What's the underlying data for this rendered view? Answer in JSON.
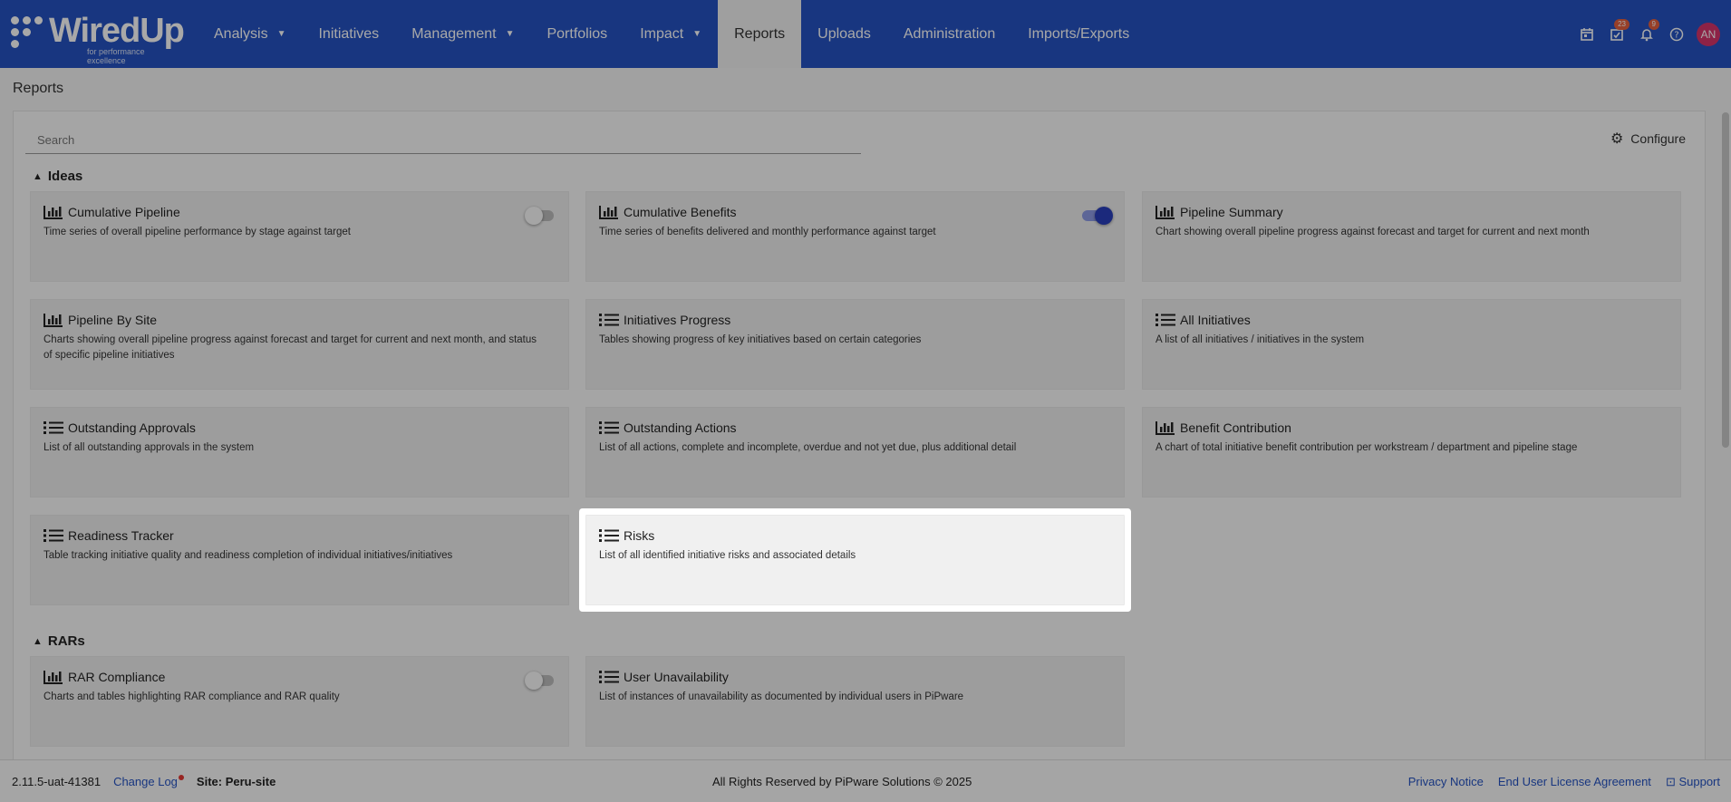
{
  "app": {
    "logo_text": "WiredUp",
    "logo_tagline": "for performance excellence"
  },
  "nav": [
    {
      "label": "Analysis",
      "dropdown": true,
      "active": false
    },
    {
      "label": "Initiatives",
      "dropdown": false,
      "active": false
    },
    {
      "label": "Management",
      "dropdown": true,
      "active": false
    },
    {
      "label": "Portfolios",
      "dropdown": false,
      "active": false
    },
    {
      "label": "Impact",
      "dropdown": true,
      "active": false
    },
    {
      "label": "Reports",
      "dropdown": false,
      "active": true
    },
    {
      "label": "Uploads",
      "dropdown": false,
      "active": false
    },
    {
      "label": "Administration",
      "dropdown": false,
      "active": false
    },
    {
      "label": "Imports/Exports",
      "dropdown": false,
      "active": false
    }
  ],
  "top_icons": {
    "tasks_badge": "23",
    "notifications_badge": "9",
    "avatar_initials": "AN"
  },
  "page": {
    "title": "Reports",
    "search_placeholder": "Search",
    "configure_label": "Configure"
  },
  "sections": [
    {
      "title": "Ideas",
      "cards": [
        {
          "icon": "bar-chart",
          "title": "Cumulative Pipeline",
          "desc": "Time series of overall pipeline performance by stage against target",
          "toggle": "off"
        },
        {
          "icon": "bar-chart",
          "title": "Cumulative Benefits",
          "desc": "Time series of benefits delivered and monthly performance against target",
          "toggle": "on"
        },
        {
          "icon": "bar-chart",
          "title": "Pipeline Summary",
          "desc": "Chart showing overall pipeline progress against forecast and target for current and next month",
          "toggle": null
        },
        {
          "icon": "bar-chart",
          "title": "Pipeline By Site",
          "desc": "Charts showing overall pipeline progress against forecast and target for current and next month, and status of specific pipeline initiatives",
          "toggle": null
        },
        {
          "icon": "list",
          "title": "Initiatives Progress",
          "desc": "Tables showing progress of key initiatives based on certain categories",
          "toggle": null
        },
        {
          "icon": "list",
          "title": "All Initiatives",
          "desc": "A list of all initiatives / initiatives in the system",
          "toggle": null
        },
        {
          "icon": "list",
          "title": "Outstanding Approvals",
          "desc": "List of all outstanding approvals in the system",
          "toggle": null
        },
        {
          "icon": "list",
          "title": "Outstanding Actions",
          "desc": "List of all actions, complete and incomplete, overdue and not yet due, plus additional detail",
          "toggle": null
        },
        {
          "icon": "bar-chart",
          "title": "Benefit Contribution",
          "desc": "A chart of total initiative benefit contribution per workstream / department and pipeline stage",
          "toggle": null
        },
        {
          "icon": "list",
          "title": "Readiness Tracker",
          "desc": "Table tracking initiative quality and readiness completion of individual initiatives/initiatives",
          "toggle": null
        },
        {
          "icon": "list",
          "title": "Risks",
          "desc": "List of all identified initiative risks and associated details",
          "toggle": null,
          "highlighted": true
        }
      ]
    },
    {
      "title": "RARs",
      "cards": [
        {
          "icon": "bar-chart",
          "title": "RAR Compliance",
          "desc": "Charts and tables highlighting RAR compliance and RAR quality",
          "toggle": "off"
        },
        {
          "icon": "list",
          "title": "User Unavailability",
          "desc": "List of instances of unavailability as documented by individual users in PiPware",
          "toggle": null
        }
      ]
    }
  ],
  "footer": {
    "version": "2.11.5-uat-41381",
    "change_log": "Change Log",
    "site": "Site: Peru-site",
    "copyright": "All Rights Reserved by PiPware Solutions © 2025",
    "privacy": "Privacy Notice",
    "eula": "End User License Agreement",
    "support": "Support"
  },
  "colors": {
    "nav_bg": "#2553c2",
    "toggle_on": "#2a3fbd",
    "badge": "#e5603e",
    "avatar": "#d7356b"
  }
}
